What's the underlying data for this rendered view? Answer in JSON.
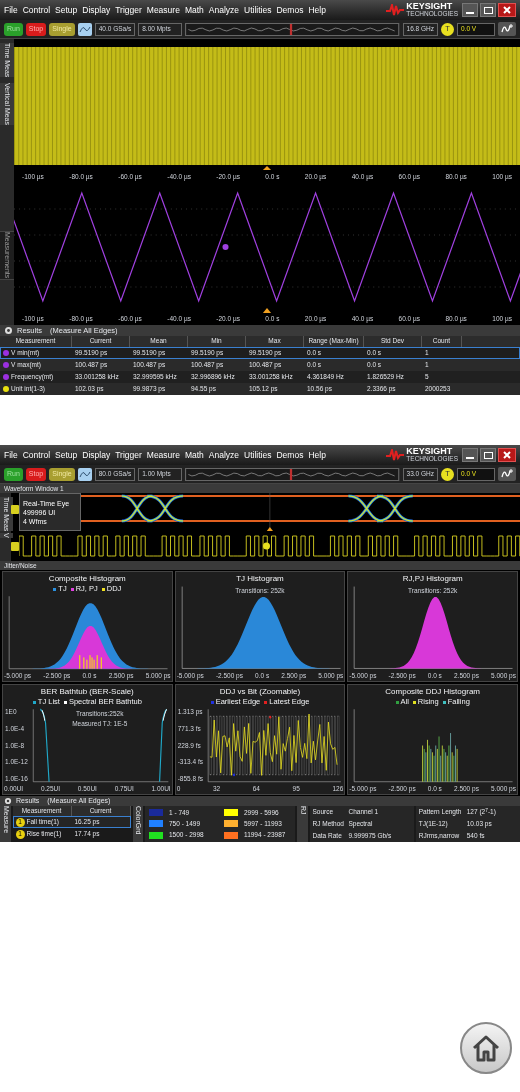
{
  "top_screen": {
    "menu": [
      "File",
      "Control",
      "Setup",
      "Display",
      "Trigger",
      "Measure",
      "Math",
      "Analyze",
      "Utilities",
      "Demos",
      "Help"
    ],
    "brand": {
      "name": "KEYSIGHT",
      "sub": "TECHNOLOGIES"
    },
    "run_buttons": [
      {
        "label": "Run",
        "kind": "run"
      },
      {
        "label": "Stop",
        "kind": "stop"
      },
      {
        "label": "Single",
        "kind": "single"
      }
    ],
    "sample_rate": "40.0 GSa/s",
    "memory": "8.00 Mpts",
    "bandwidth": "16.8 GHz",
    "trigger_badge": "T",
    "trigger_level": "0.0 V",
    "side_tabs": [
      {
        "label": "Time Meas",
        "disabled": false
      },
      {
        "label": "Vertical Meas",
        "disabled": false
      },
      {
        "label": "Measurements",
        "disabled": true
      }
    ],
    "plots": [
      {
        "kind": "noise",
        "x_ticks": [
          "-100 µs",
          "-80.0 µs",
          "-60.0 µs",
          "-40.0 µs",
          "-20.0 µs",
          "0.0 s",
          "20.0 µs",
          "40.0 µs",
          "60.0 µs",
          "80.0 µs",
          "100 µs"
        ]
      },
      {
        "kind": "triangle",
        "x_ticks": [
          "-100 µs",
          "-80.0 µs",
          "-60.0 µs",
          "-40.0 µs",
          "-20.0 µs",
          "0.0 s",
          "20.0 µs",
          "40.0 µs",
          "60.0 µs",
          "80.0 µs",
          "100 µs"
        ]
      }
    ],
    "results": {
      "title": "Results",
      "subtitle": "(Measure All Edges)",
      "columns": [
        "Measurement",
        "Current",
        "Mean",
        "Min",
        "Max",
        "Range (Max-Min)",
        "Std Dev",
        "Count"
      ],
      "rows": [
        {
          "color": "#9b30e0",
          "selected": true,
          "cells": [
            "V min(mt)",
            "99.5190 ps",
            "99.5190 ps",
            "99.5190 ps",
            "99.5190 ps",
            "0.0 s",
            "0.0 s",
            "1"
          ]
        },
        {
          "color": "#9b30e0",
          "selected": false,
          "cells": [
            "V max(mt)",
            "100.487 ps",
            "100.487 ps",
            "100.487 ps",
            "100.487 ps",
            "0.0 s",
            "0.0 s",
            "1"
          ]
        },
        {
          "color": "#9b30e0",
          "selected": false,
          "cells": [
            "Frequency(mt)",
            "33.001258 kHz",
            "32.999595 kHz",
            "32.996896 kHz",
            "33.001258 kHz",
            "4.361849 Hz",
            "1.826529 Hz",
            "5"
          ]
        },
        {
          "color": "#e8e010",
          "selected": false,
          "cells": [
            "Unit int(1-3)",
            "102.03 ps",
            "99.9873 ps",
            "94.55 ps",
            "105.12 ps",
            "10.56 ps",
            "2.3366 ps",
            "2000253"
          ]
        }
      ]
    }
  },
  "bottom_screen": {
    "menu": [
      "File",
      "Control",
      "Setup",
      "Display",
      "Trigger",
      "Measure",
      "Math",
      "Analyze",
      "Utilities",
      "Demos",
      "Help"
    ],
    "brand": {
      "name": "KEYSIGHT",
      "sub": "TECHNOLOGIES"
    },
    "run_buttons": [
      {
        "label": "Run",
        "kind": "run"
      },
      {
        "label": "Stop",
        "kind": "stop"
      },
      {
        "label": "Single",
        "kind": "single"
      }
    ],
    "sample_rate": "80.0 GSa/s",
    "memory": "1.00 Mpts",
    "bandwidth": "33.0 GHz",
    "trigger_badge": "T",
    "trigger_level": "0.0 V",
    "waveform_window": {
      "title": "Waveform Window 1",
      "side_tabs": [
        "Time Meas",
        "V"
      ],
      "eye_label": [
        "Real-Time Eye",
        "499996 UI",
        "4 Wfms"
      ]
    },
    "jitter": {
      "title": "Jitter/Noise",
      "panels": [
        {
          "kind": "composite",
          "title": "Composite Histogram",
          "legend": [
            {
              "label": "TJ",
              "color": "#2a90e0"
            },
            {
              "label": "RJ, PJ",
              "color": "#e040e0"
            },
            {
              "label": "DDJ",
              "color": "#f0e020"
            }
          ],
          "x_ticks": [
            "-5.000 ps",
            "-2.500 ps",
            "0.0 s",
            "2.500 ps",
            "5.000 ps"
          ]
        },
        {
          "kind": "tj",
          "title": "TJ Histogram",
          "notes": [
            "Transitions: 252k"
          ],
          "x_ticks": [
            "-5.000 ps",
            "-2.500 ps",
            "0.0 s",
            "2.500 ps",
            "5.000 ps"
          ]
        },
        {
          "kind": "rjpj",
          "title": "RJ,PJ Histogram",
          "notes": [
            "Transitions: 252k"
          ],
          "x_ticks": [
            "-5.000 ps",
            "-2.500 ps",
            "0.0 s",
            "2.500 ps",
            "5.000 ps"
          ]
        },
        {
          "kind": "bathtub",
          "title": "BER Bathtub (BER-Scale)",
          "legend": [
            {
              "label": "TJ List",
              "color": "#20a8c8"
            },
            {
              "label": "Spectral BER Bathtub",
              "color": "#ffffff"
            }
          ],
          "notes": [
            "Transitions:252k",
            "Measured TJ: 1E-5"
          ],
          "y_ticks": [
            "1E0",
            "1.0E-4",
            "1.0E-8",
            "1.0E-12",
            "1.0E-16"
          ],
          "x_ticks": [
            "0.00UI",
            "0.25UI",
            "0.50UI",
            "0.75UI",
            "1.00UI"
          ]
        },
        {
          "kind": "ddj",
          "title": "DDJ vs Bit (Zoomable)",
          "legend": [
            {
              "label": "Earliest Edge",
              "color": "#2030e0"
            },
            {
              "label": "Latest Edge",
              "color": "#e02020"
            }
          ],
          "y_ticks": [
            "1.313 ps",
            "771.3 fs",
            "228.9 fs",
            "-313.4 fs",
            "-855.8 fs"
          ],
          "x_ticks": [
            "0",
            "32",
            "64",
            "95",
            "126"
          ]
        },
        {
          "kind": "ddjhist",
          "title": "Composite DDJ Histogram",
          "legend": [
            {
              "label": "All",
              "color": "#30a040"
            },
            {
              "label": "Rising",
              "color": "#e0e020"
            },
            {
              "label": "Falling",
              "color": "#40c0c0"
            }
          ],
          "x_ticks": [
            "-5.000 ps",
            "-2.500 ps",
            "0.0 s",
            "2.500 ps",
            "5.000 ps"
          ]
        }
      ]
    },
    "results": {
      "title": "Results",
      "subtitle": "(Measure All Edges)",
      "side_tab": "Measure",
      "columns": [
        "Measurement",
        "Current"
      ],
      "rows": [
        {
          "selected": true,
          "badge": "1",
          "cells": [
            "Fall time(1)",
            "16.25 ps"
          ]
        },
        {
          "selected": false,
          "badge": "1",
          "cells": [
            "Rise time(1)",
            "17.74 ps"
          ]
        }
      ],
      "color_grade_tab": "ColorGrd",
      "color_grade": [
        {
          "label": "1 - 749",
          "color": "#1a2a9a"
        },
        {
          "label": "750 - 1499",
          "color": "#2080ff"
        },
        {
          "label": "1500 - 2998",
          "color": "#20e020"
        },
        {
          "label": "2999 - 5996",
          "color": "#ffff00"
        },
        {
          "label": "5997 - 11993",
          "color": "#ffb030"
        },
        {
          "label": "11994 - 23987",
          "color": "#ff7020"
        }
      ],
      "info_tab": "RJ",
      "info": [
        [
          {
            "label": "Source",
            "value": "Channel 1"
          },
          {
            "label": "RJ Method",
            "value": "Spectral"
          },
          {
            "label": "Data Rate",
            "value": "9.999975 Gb/s"
          }
        ],
        [
          {
            "label": "Pattern Length",
            "value": "127 (2$^{7}$-1)"
          },
          {
            "label": "TJ(1E-12)",
            "value": "10.03 ps"
          },
          {
            "label": "RJrms,narrow",
            "value": "540 fs"
          }
        ]
      ]
    }
  }
}
